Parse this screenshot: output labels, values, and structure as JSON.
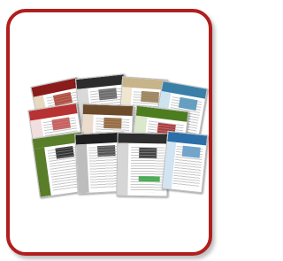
{
  "image": {
    "subject": "website-template-collage",
    "frame_color": "#b11e1e",
    "page_accents": [
      "#8a1c1c",
      "#2c2c2c",
      "#5a7d2a",
      "#3a7fa8",
      "#c8b48a",
      "#6b4b2a",
      "#9fb7c8",
      "#4c7d1f",
      "#b73232",
      "#2c6fa8"
    ]
  }
}
